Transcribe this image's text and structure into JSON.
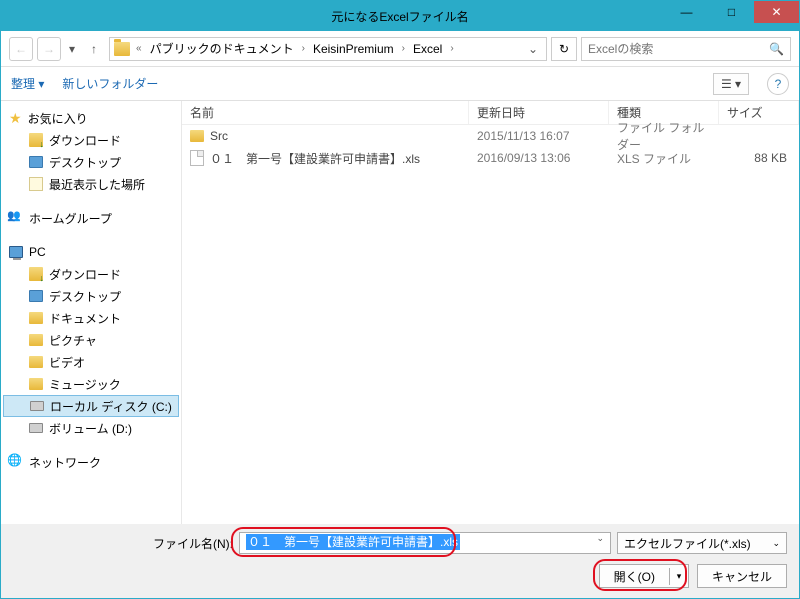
{
  "title": "元になるExcelファイル名",
  "nav": {
    "prefix": "«",
    "crumbs": [
      "パブリックのドキュメント",
      "KeisinPremium",
      "Excel"
    ],
    "search_placeholder": "Excelの検索"
  },
  "toolbar": {
    "organize": "整理 ▾",
    "new_folder": "新しいフォルダー"
  },
  "sidebar": {
    "favorites": "お気に入り",
    "fav_items": [
      "ダウンロード",
      "デスクトップ",
      "最近表示した場所"
    ],
    "homegroup": "ホームグループ",
    "pc": "PC",
    "pc_items": [
      "ダウンロード",
      "デスクトップ",
      "ドキュメント",
      "ピクチャ",
      "ビデオ",
      "ミュージック",
      "ローカル ディスク (C:)",
      "ボリューム (D:)"
    ],
    "network": "ネットワーク"
  },
  "columns": {
    "name": "名前",
    "date": "更新日時",
    "type": "種類",
    "size": "サイズ"
  },
  "files": [
    {
      "name": "Src",
      "date": "2015/11/13 16:07",
      "type": "ファイル フォルダー",
      "size": ""
    },
    {
      "name": "０１　第一号【建設業許可申請書】.xls",
      "date": "2016/09/13 13:06",
      "type": "XLS ファイル",
      "size": "88 KB"
    }
  ],
  "bottom": {
    "filename_label": "ファイル名(N):",
    "filename_value": "０１　第一号【建設業許可申請書】.xls",
    "filetype": "エクセルファイル(*.xls)",
    "open": "開く(O)",
    "cancel": "キャンセル"
  }
}
